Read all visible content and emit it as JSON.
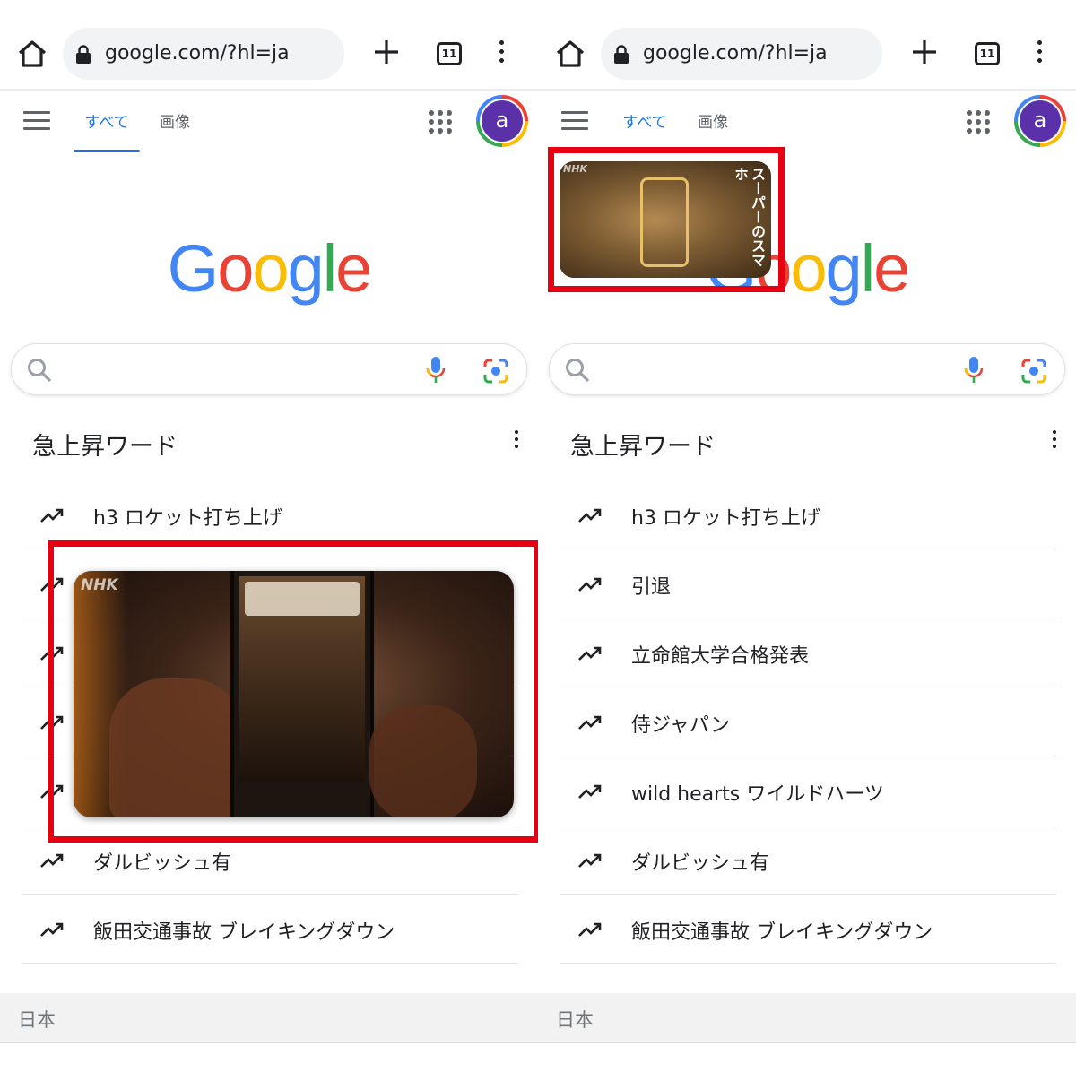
{
  "browser": {
    "url": "google.com/?hl=ja",
    "tab_count": "11"
  },
  "header": {
    "tab_all": "すべて",
    "tab_images": "画像",
    "avatar_letter": "a"
  },
  "logo": {
    "letters": [
      "G",
      "o",
      "o",
      "g",
      "l",
      "e"
    ]
  },
  "trending": {
    "title": "急上昇ワード",
    "items": [
      "h3 ロケット打ち上げ",
      "引退",
      "立命館大学合格発表",
      "侍ジャパン",
      "wild hearts ワイルドハーツ",
      "ダルビッシュ有",
      "飯田交通事故 ブレイキングダウン"
    ]
  },
  "footer": {
    "country": "日本"
  },
  "overlays": {
    "video_watermark": "NHK",
    "gold_title": "スーパーのスマホ",
    "highlight_color": "#e60012"
  },
  "colors": {
    "accent": "#1a73e8",
    "avatar_bg": "#5a31a8"
  }
}
